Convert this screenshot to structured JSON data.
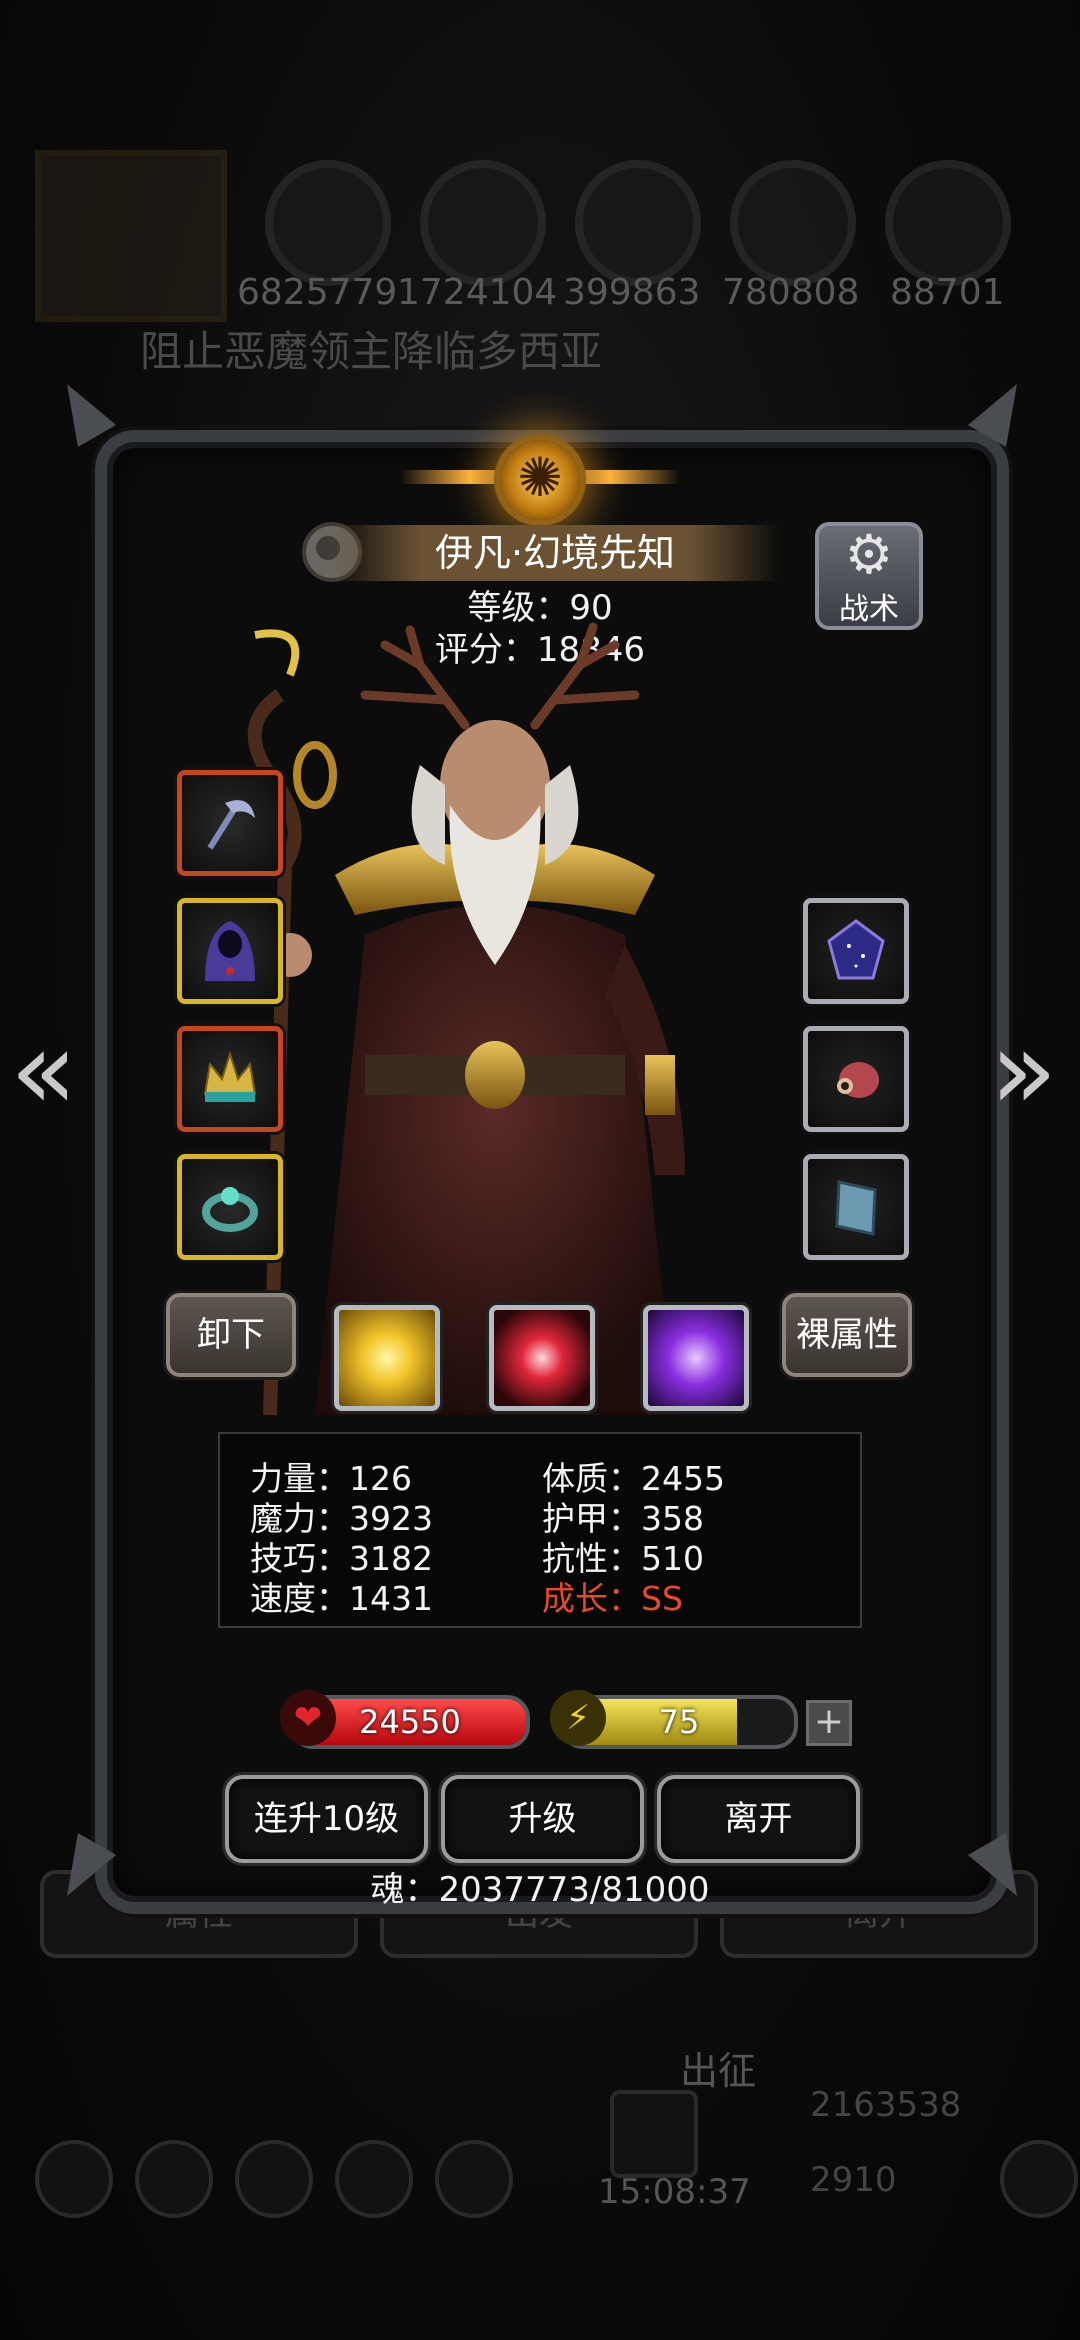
{
  "background": {
    "resources": [
      "6825779",
      "1724104",
      "399863",
      "780808",
      "88701"
    ],
    "quest_title": "阻止恶魔领主降临多西亚",
    "bottom_tabs": [
      "属性",
      "出发",
      "离开"
    ],
    "expedition_label": "出征",
    "currency_gold": "2163538",
    "currency_gem": "2910",
    "clock": "15:08:37"
  },
  "hero": {
    "name": "伊凡·幻境先知",
    "level_text": "等级：90",
    "score_text": "评分：18846"
  },
  "header": {
    "tactics_label": "战术"
  },
  "equipment": {
    "left": [
      {
        "icon": "scythe-weapon-icon",
        "rarity": "red"
      },
      {
        "icon": "hooded-cloak-icon",
        "rarity": "gold"
      },
      {
        "icon": "crown-helmet-icon",
        "rarity": "red"
      },
      {
        "icon": "emerald-ring-icon",
        "rarity": "gold"
      }
    ],
    "right": [
      {
        "icon": "star-gem-icon",
        "rarity": "silver"
      },
      {
        "icon": "eye-charm-icon",
        "rarity": "silver"
      },
      {
        "icon": "blue-book-icon",
        "rarity": "silver"
      }
    ]
  },
  "actions": {
    "unequip_label": "卸下",
    "naked_attr_label": "裸属性",
    "skills": [
      "radiant-burst-icon",
      "crimson-slash-icon",
      "violet-phantom-icon"
    ]
  },
  "stats": {
    "strength": "力量：126",
    "magic": "魔力：3923",
    "skill": "技巧：3182",
    "speed": "速度：1431",
    "constitution": "体质：2455",
    "armor": "护甲：358",
    "resistance": "抗性：510",
    "growth": "成长：SS"
  },
  "bars": {
    "hp_value": "24550",
    "hp_fill": 1.0,
    "energy_value": "75",
    "energy_fill": 0.75
  },
  "buttons": {
    "level_up_10": "连升10级",
    "level_up": "升级",
    "leave": "离开"
  },
  "soul_text": "魂：2037773/81000",
  "colors": {
    "hp": "#d9171c",
    "energy": "#d8c21a",
    "growth": "#e8492a",
    "rarity_red": "#c6461f",
    "rarity_gold": "#d7b629"
  }
}
